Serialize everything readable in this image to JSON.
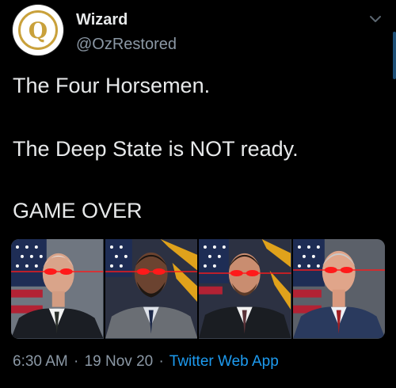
{
  "author": {
    "display_name": "Wizard",
    "handle": "@OzRestored",
    "avatar_letter": "Q"
  },
  "tweet": {
    "lines": [
      "The Four Horsemen.",
      "The Deep State is NOT ready.",
      "GAME OVER"
    ],
    "time": "6:30 AM",
    "separator": "·",
    "date": "19 Nov 20",
    "source": "Twitter Web App"
  },
  "colors": {
    "background": "#000000",
    "text": "#e7e9ea",
    "secondary": "#8b98a5",
    "link": "#1d9bf0",
    "avatar_gold": "#c9a13b",
    "laser_eyes": "#ff1a1a"
  },
  "media": {
    "photos": [
      {
        "name": "photo-1",
        "icon": "man-white-hair-flag-bg"
      },
      {
        "name": "photo-2",
        "icon": "man-beard-flag-bg"
      },
      {
        "name": "photo-3",
        "icon": "man-dark-hair-flag-bg"
      },
      {
        "name": "photo-4",
        "icon": "man-grey-hair-flag-bg"
      }
    ]
  }
}
